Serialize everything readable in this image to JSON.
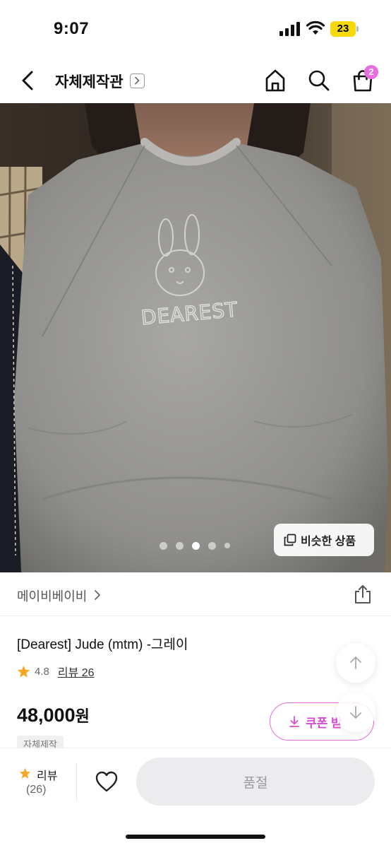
{
  "status_bar": {
    "time": "9:07",
    "battery_level": "23",
    "icons": [
      "signal-icon",
      "wifi-icon",
      "battery-icon"
    ]
  },
  "nav": {
    "title": "자체제작관",
    "cart_count": "2",
    "icons": [
      "back-icon",
      "chevron-right-icon",
      "home-icon",
      "search-icon",
      "cart-icon"
    ]
  },
  "gallery": {
    "total_images": 5,
    "current_index": 3,
    "similar_button_label": "비슷한 상품",
    "similar_icon": "copy-icon",
    "image_text": "DEAREST"
  },
  "shop": {
    "name": "메이비베이비",
    "share_icon": "share-icon"
  },
  "product": {
    "title": "[Dearest] Jude (mtm) -그레이",
    "rating": "4.8",
    "review_link": "리뷰 26",
    "price_amount": "48,000",
    "price_unit": "원",
    "tag": "자체제작"
  },
  "coupon": {
    "label": "쿠폰 받",
    "icon": "download-icon"
  },
  "bottom_bar": {
    "review_label": "리뷰",
    "review_count": "(26)",
    "action_label": "품절"
  },
  "colors": {
    "accent_pink": "#e96de0",
    "star_orange": "#f5a623",
    "battery_yellow": "#f5d90a",
    "disabled_button": "#ececee"
  }
}
